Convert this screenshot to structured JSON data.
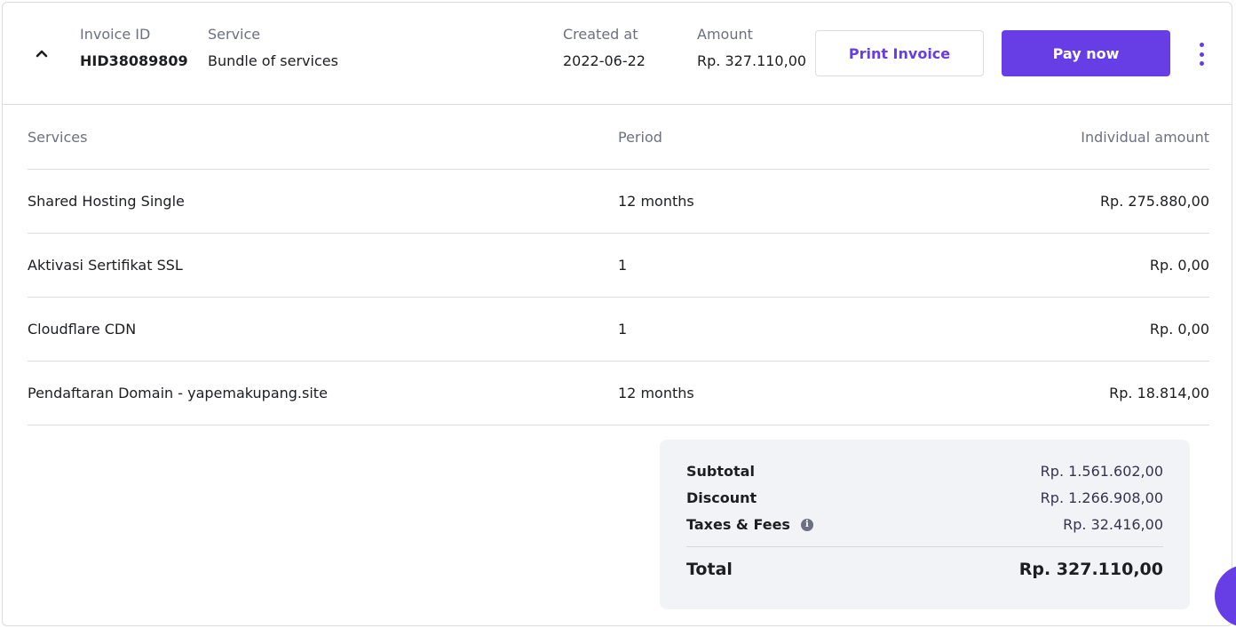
{
  "invoice": {
    "invoice_id_label": "Invoice ID",
    "invoice_id": "HID38089809",
    "service_label": "Service",
    "service": "Bundle of services",
    "created_label": "Created at",
    "created": "2022-06-22",
    "amount_label": "Amount",
    "amount": "Rp. 327.110,00",
    "print_label": "Print Invoice",
    "pay_label": "Pay now",
    "collapse_icon": "chevron-up-icon",
    "menu_icon": "more-vertical-icon"
  },
  "table": {
    "headers": {
      "services": "Services",
      "period": "Period",
      "amount": "Individual amount"
    },
    "rows": [
      {
        "service": "Shared Hosting Single",
        "period": "12 months",
        "amount": "Rp. 275.880,00"
      },
      {
        "service": "Aktivasi Sertifikat SSL",
        "period": "1",
        "amount": "Rp. 0,00"
      },
      {
        "service": "Cloudflare CDN",
        "period": "1",
        "amount": "Rp. 0,00"
      },
      {
        "service": "Pendaftaran Domain - yapemakupang.site",
        "period": "12 months",
        "amount": "Rp. 18.814,00"
      }
    ]
  },
  "summary": {
    "subtotal_label": "Subtotal",
    "subtotal": "Rp. 1.561.602,00",
    "discount_label": "Discount",
    "discount": "Rp. 1.266.908,00",
    "taxes_label": "Taxes & Fees",
    "taxes": "Rp. 32.416,00",
    "total_label": "Total",
    "total": "Rp. 327.110,00",
    "info_icon": "info-icon"
  },
  "colors": {
    "primary": "#673de6",
    "text": "#1d1e20",
    "muted": "#6d7081",
    "summary_bg": "#f2f3f6"
  }
}
